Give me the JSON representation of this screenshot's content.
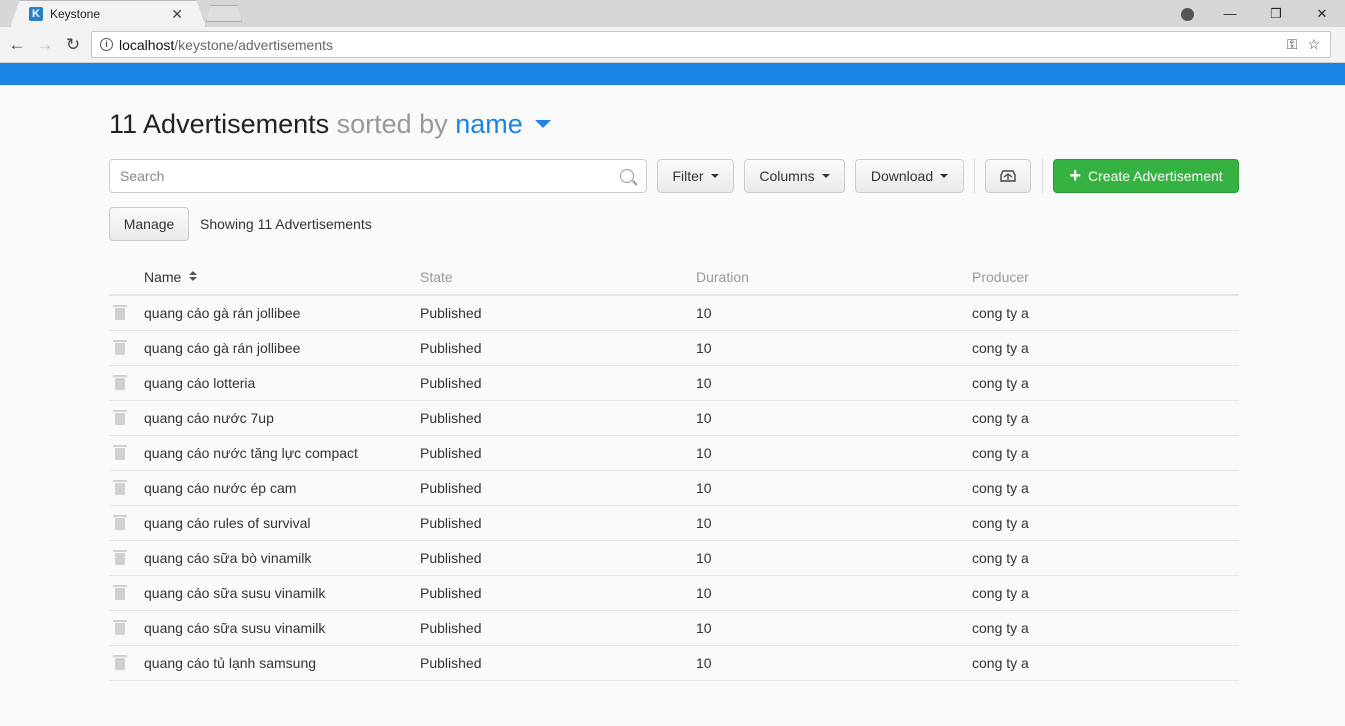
{
  "browser": {
    "tab_title": "Keystone",
    "tab_favicon": "K",
    "url_host": "localhost",
    "url_path": "/keystone/advertisements"
  },
  "header": {
    "count_label": "11 Advertisements",
    "sorted_label": "sorted by",
    "sort_field": "name"
  },
  "toolbar": {
    "search_placeholder": "Search",
    "filter_label": "Filter",
    "columns_label": "Columns",
    "download_label": "Download",
    "create_label": "Create Advertisement",
    "manage_label": "Manage",
    "showing_label": "Showing 11 Advertisements"
  },
  "table": {
    "columns": [
      "Name",
      "State",
      "Duration",
      "Producer"
    ],
    "rows": [
      {
        "name": "quang cáo gà rán jollibee",
        "state": "Published",
        "duration": "10",
        "producer": "cong ty a"
      },
      {
        "name": "quang cáo gà rán jollibee",
        "state": "Published",
        "duration": "10",
        "producer": "cong ty a"
      },
      {
        "name": "quang cáo lotteria",
        "state": "Published",
        "duration": "10",
        "producer": "cong ty a"
      },
      {
        "name": "quang cáo nước 7up",
        "state": "Published",
        "duration": "10",
        "producer": "cong ty a"
      },
      {
        "name": "quang cáo nước tăng lực compact",
        "state": "Published",
        "duration": "10",
        "producer": "cong ty a"
      },
      {
        "name": "quang cáo nước ép cam",
        "state": "Published",
        "duration": "10",
        "producer": "cong ty a"
      },
      {
        "name": "quang cáo rules of survival",
        "state": "Published",
        "duration": "10",
        "producer": "cong ty a"
      },
      {
        "name": "quang cáo sữa bò vinamilk",
        "state": "Published",
        "duration": "10",
        "producer": "cong ty a"
      },
      {
        "name": "quang cáo sữa susu vinamilk",
        "state": "Published",
        "duration": "10",
        "producer": "cong ty a"
      },
      {
        "name": "quang cáo sữa susu vinamilk",
        "state": "Published",
        "duration": "10",
        "producer": "cong ty a"
      },
      {
        "name": "quang cáo tủ lạnh samsung",
        "state": "Published",
        "duration": "10",
        "producer": "cong ty a"
      }
    ]
  },
  "colors": {
    "brand_blue": "#1b85e3",
    "create_green": "#35b241"
  }
}
